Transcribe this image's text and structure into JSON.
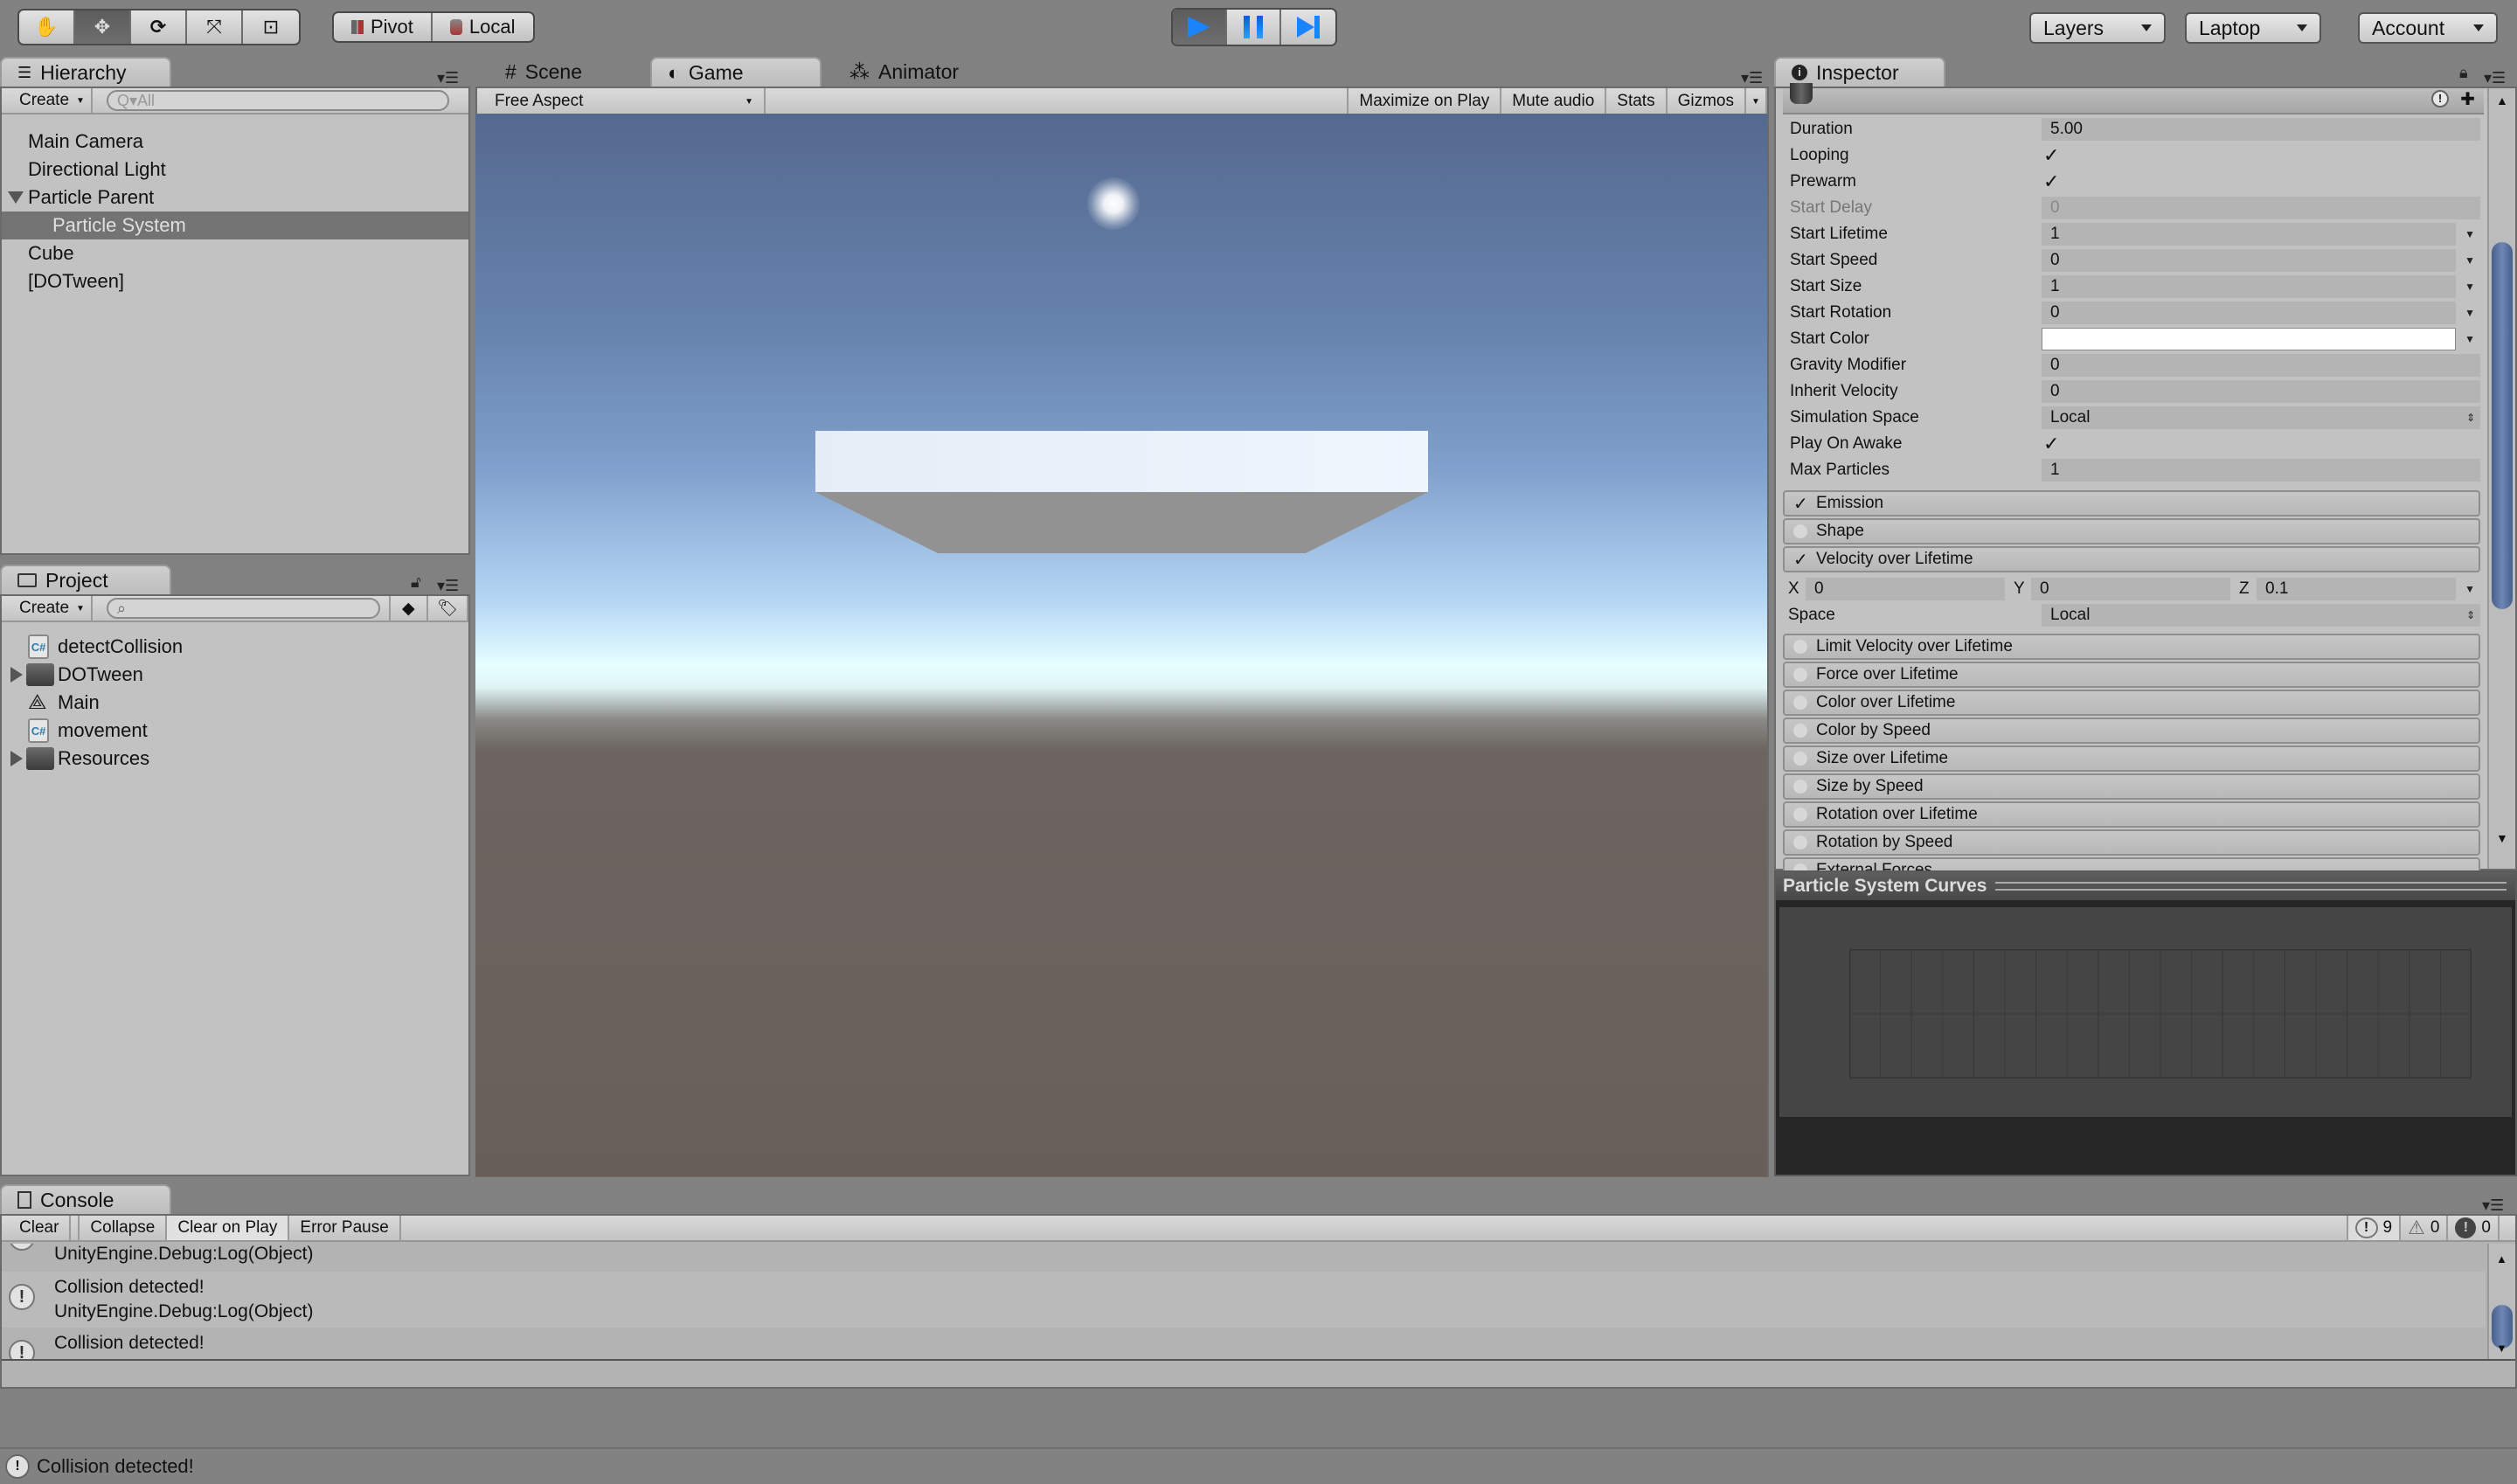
{
  "toolbar": {
    "tools": [
      {
        "name": "hand-tool",
        "icon": "hand-icon",
        "glyph": "✋",
        "active": false
      },
      {
        "name": "move-tool",
        "icon": "move-icon",
        "glyph": "✥",
        "active": true
      },
      {
        "name": "rotate-tool",
        "icon": "rotate-icon",
        "glyph": "⟳",
        "active": false
      },
      {
        "name": "scale-tool",
        "icon": "scale-icon",
        "glyph": "⤧",
        "active": false
      },
      {
        "name": "rect-tool",
        "icon": "rect-icon",
        "glyph": "⊡",
        "active": false
      }
    ],
    "pivot_label": "Pivot",
    "local_label": "Local",
    "layers_label": "Layers",
    "layout_label": "Laptop",
    "account_label": "Account",
    "play_active": true
  },
  "hierarchy": {
    "tab_label": "Hierarchy",
    "create_label": "Create",
    "search_placeholder": "Q▾All",
    "items": [
      {
        "label": "Main Camera",
        "depth": 0,
        "selected": false,
        "foldout": null
      },
      {
        "label": "Directional Light",
        "depth": 0,
        "selected": false,
        "foldout": null
      },
      {
        "label": "Particle Parent",
        "depth": 0,
        "selected": false,
        "foldout": "open"
      },
      {
        "label": "Particle System",
        "depth": 1,
        "selected": true,
        "foldout": null
      },
      {
        "label": "Cube",
        "depth": 0,
        "selected": false,
        "foldout": null
      },
      {
        "label": "[DOTween]",
        "depth": 0,
        "selected": false,
        "foldout": null
      }
    ]
  },
  "project": {
    "tab_label": "Project",
    "create_label": "Create",
    "search_placeholder": "",
    "items": [
      {
        "label": "detectCollision",
        "type": "script",
        "foldout": null
      },
      {
        "label": "DOTween",
        "type": "folder",
        "foldout": "closed"
      },
      {
        "label": "Main",
        "type": "scene",
        "foldout": null
      },
      {
        "label": "movement",
        "type": "script",
        "foldout": null
      },
      {
        "label": "Resources",
        "type": "folder",
        "foldout": "closed"
      }
    ]
  },
  "game": {
    "tabs": [
      {
        "label": "Scene",
        "icon": "scene-icon",
        "glyph": "#",
        "active": false
      },
      {
        "label": "Game",
        "icon": "game-icon",
        "glyph": "◐",
        "active": true
      },
      {
        "label": "Animator",
        "icon": "animator-icon",
        "glyph": "⁂",
        "active": false
      }
    ],
    "aspect_label": "Free Aspect",
    "maximize_label": "Maximize on Play",
    "mute_label": "Mute audio",
    "stats_label": "Stats",
    "gizmos_label": "Gizmos"
  },
  "inspector": {
    "tab_label": "Inspector",
    "properties": [
      {
        "label": "Duration",
        "value": "5.00",
        "kind": "field",
        "disabled": false
      },
      {
        "label": "Looping",
        "value": "✓",
        "kind": "check",
        "disabled": false
      },
      {
        "label": "Prewarm",
        "value": "✓",
        "kind": "check",
        "disabled": false
      },
      {
        "label": "Start Delay",
        "value": "0",
        "kind": "field",
        "disabled": true
      },
      {
        "label": "Start Lifetime",
        "value": "1",
        "kind": "curve",
        "disabled": false
      },
      {
        "label": "Start Speed",
        "value": "0",
        "kind": "curve",
        "disabled": false
      },
      {
        "label": "Start Size",
        "value": "1",
        "kind": "curve",
        "disabled": false
      },
      {
        "label": "Start Rotation",
        "value": "0",
        "kind": "curve",
        "disabled": false
      },
      {
        "label": "Start Color",
        "value": "#ffffff",
        "kind": "color",
        "disabled": false
      },
      {
        "label": "Gravity Modifier",
        "value": "0",
        "kind": "field",
        "disabled": false
      },
      {
        "label": "Inherit Velocity",
        "value": "0",
        "kind": "field",
        "disabled": false
      },
      {
        "label": "Simulation Space",
        "value": "Local",
        "kind": "enum",
        "disabled": false
      },
      {
        "label": "Play On Awake",
        "value": "✓",
        "kind": "check",
        "disabled": false
      },
      {
        "label": "Max Particles",
        "value": "1",
        "kind": "field",
        "disabled": false
      }
    ],
    "modules_top": [
      {
        "label": "Emission",
        "enabled": true
      },
      {
        "label": "Shape",
        "enabled": false
      },
      {
        "label": "Velocity over Lifetime",
        "enabled": true
      }
    ],
    "velocity": {
      "x_label": "X",
      "x_value": "0",
      "y_label": "Y",
      "y_value": "0",
      "z_label": "Z",
      "z_value": "0.1",
      "space_label": "Space",
      "space_value": "Local"
    },
    "modules_bottom": [
      {
        "label": "Limit Velocity over Lifetime",
        "enabled": false
      },
      {
        "label": "Force over Lifetime",
        "enabled": false
      },
      {
        "label": "Color over Lifetime",
        "enabled": false
      },
      {
        "label": "Color by Speed",
        "enabled": false
      },
      {
        "label": "Size over Lifetime",
        "enabled": false
      },
      {
        "label": "Size by Speed",
        "enabled": false
      },
      {
        "label": "Rotation over Lifetime",
        "enabled": false
      },
      {
        "label": "Rotation by Speed",
        "enabled": false
      },
      {
        "label": "External Forces",
        "enabled": false
      }
    ],
    "curves_title": "Particle System Curves"
  },
  "console": {
    "tab_label": "Console",
    "buttons": [
      {
        "label": "Clear",
        "pressed": false
      },
      {
        "label": "Collapse",
        "pressed": false
      },
      {
        "label": "Clear on Play",
        "pressed": true
      },
      {
        "label": "Error Pause",
        "pressed": false
      }
    ],
    "counts": {
      "log": "9",
      "warning": "0",
      "error": "0"
    },
    "entries": [
      {
        "line1": "Collision detected!",
        "line2": "UnityEngine.Debug:Log(Object)"
      },
      {
        "line1": "Collision detected!",
        "line2": "UnityEngine.Debug:Log(Object)"
      },
      {
        "line1": "Collision detected!",
        "line2": "UnityEngine.Debug:Log(Object)"
      }
    ],
    "status_message": "Collision detected!"
  },
  "colors": {
    "play_blue": "#1a84ff",
    "selection": "#737373",
    "editor_bg": "#c2c2c2",
    "scrollbar_thumb": "#5c75a3"
  }
}
